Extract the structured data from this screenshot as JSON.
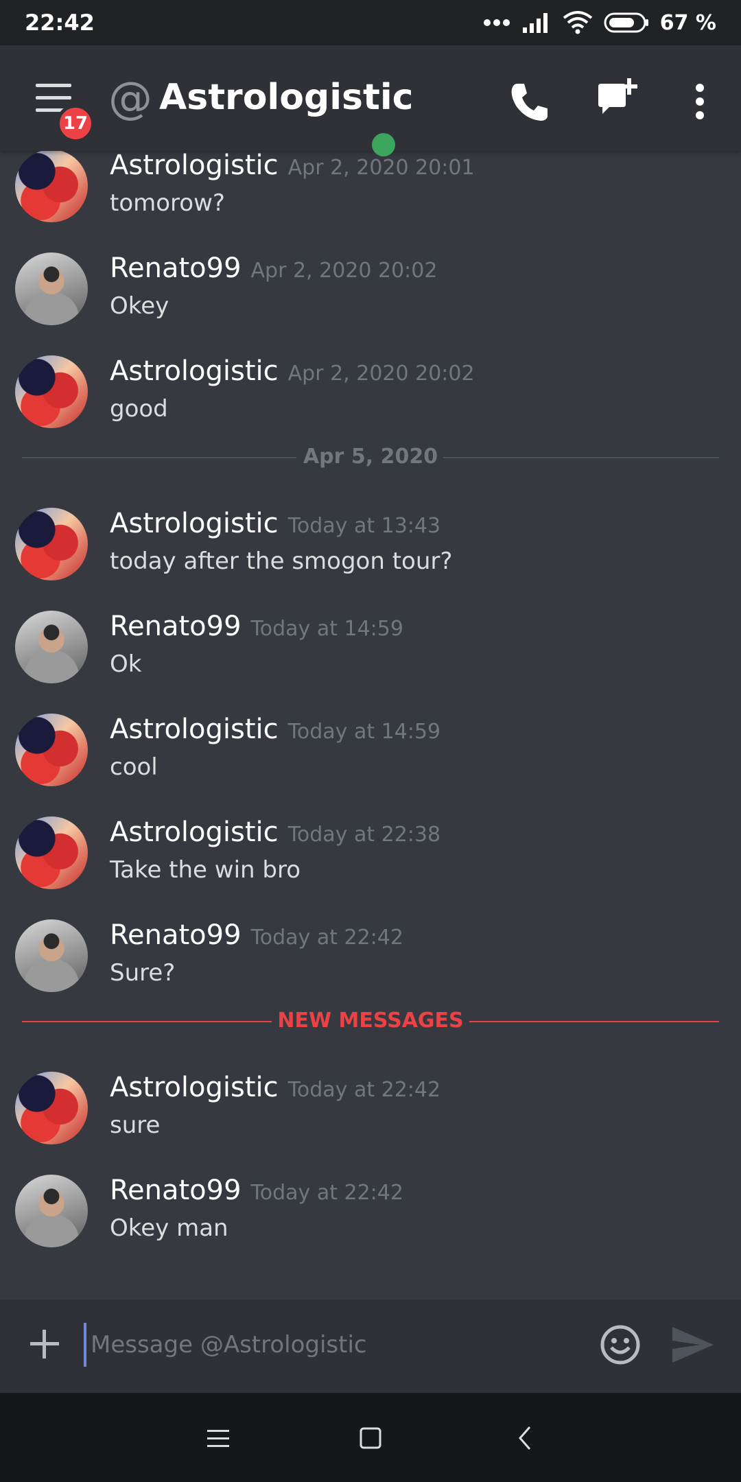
{
  "status_bar": {
    "time": "22:42",
    "battery": "67 %"
  },
  "header": {
    "at_symbol": "@",
    "title": "Astrologistic",
    "notification_count": "17"
  },
  "messages": [
    {
      "author": "Astrologistic",
      "timestamp": "Apr 2, 2020 20:01",
      "text": "tomorow?",
      "avatar": "astrologistic"
    },
    {
      "author": "Renato99",
      "timestamp": "Apr 2, 2020 20:02",
      "text": "Okey",
      "avatar": "renato99"
    },
    {
      "author": "Astrologistic",
      "timestamp": "Apr 2, 2020 20:02",
      "text": "good",
      "avatar": "astrologistic"
    },
    {
      "author": "Astrologistic",
      "timestamp": "Today at 13:43",
      "text": "today after the smogon tour?",
      "avatar": "astrologistic"
    },
    {
      "author": "Renato99",
      "timestamp": "Today at 14:59",
      "text": "Ok",
      "avatar": "renato99"
    },
    {
      "author": "Astrologistic",
      "timestamp": "Today at 14:59",
      "text": "cool",
      "avatar": "astrologistic"
    },
    {
      "author": "Astrologistic",
      "timestamp": "Today at 22:38",
      "text": "Take the win bro",
      "avatar": "astrologistic"
    },
    {
      "author": "Renato99",
      "timestamp": "Today at 22:42",
      "text": "Sure?",
      "avatar": "renato99"
    },
    {
      "author": "Astrologistic",
      "timestamp": "Today at 22:42",
      "text": "sure",
      "avatar": "astrologistic"
    },
    {
      "author": "Renato99",
      "timestamp": "Today at 22:42",
      "text": "Okey man",
      "avatar": "renato99"
    }
  ],
  "dividers": {
    "date": "Apr 5, 2020",
    "new_messages": "NEW MESSAGES"
  },
  "composer": {
    "placeholder": "Message @Astrologistic"
  },
  "colors": {
    "accent": "#7289da",
    "online": "#3ba55d",
    "alert": "#ed4245",
    "background": "#36393f"
  },
  "icons": [
    "menu-icon",
    "at-icon",
    "phone-icon",
    "new-dm-icon",
    "more-icon",
    "plus-icon",
    "emoji-icon",
    "send-icon",
    "nav-recents-icon",
    "nav-home-icon",
    "nav-back-icon"
  ]
}
